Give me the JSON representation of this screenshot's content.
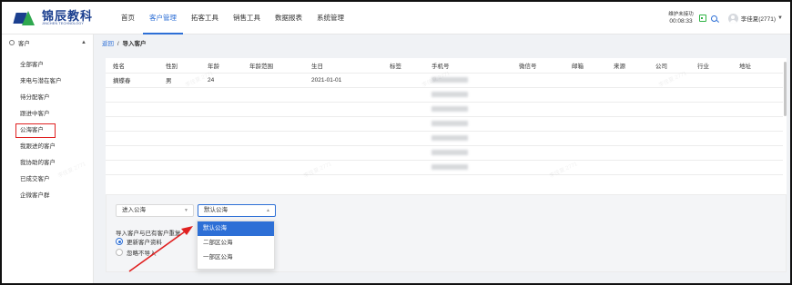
{
  "brand": {
    "name": "锦辰教科",
    "sub": "JINCHEN TECHNOLOGY",
    "colors": {
      "primary": "#2d6fd6",
      "brand_blue": "#1b3f8f",
      "brand_green": "#2fa84f",
      "annotation_red": "#e02020"
    }
  },
  "nav": {
    "items": [
      "首页",
      "客户管理",
      "拓客工具",
      "销售工具",
      "数据报表",
      "系统管理"
    ],
    "active": "客户管理"
  },
  "header_right": {
    "timer_label": "维护未接功",
    "timer_value": "00:08:33",
    "user_name": "李佳夏(2771)"
  },
  "sidebar": {
    "head": "客户",
    "items": [
      "全部客户",
      "来电与潜在客户",
      "待分配客户",
      "跟进中客户",
      "公海客户",
      "我跟进的客户",
      "我协助的客户",
      "已成交客户",
      "企微客户群"
    ],
    "highlighted": "公海客户"
  },
  "breadcrumb": {
    "back": "返回",
    "separator": "/",
    "current": "导入客户"
  },
  "table": {
    "columns": [
      "姓名",
      "性别",
      "年龄",
      "年龄范围",
      "生日",
      "标签",
      "手机号",
      "微信号",
      "邮箱",
      "来源",
      "公司",
      "行业",
      "地址"
    ],
    "rows": [
      {
        "name": "摘蝶春",
        "gender": "男",
        "age": "24",
        "birthday": "2021-01-01"
      }
    ],
    "empty_rows": 6
  },
  "import_config": {
    "target_select": "进入公海",
    "pool_select": "默认公海",
    "duplicate_label": "导入客户与已有客户重复",
    "radio_options": [
      "更新客户资料",
      "忽略不导入"
    ],
    "radio_selected": "更新客户资料",
    "dropdown_options": [
      "默认公海",
      "二部区公海",
      "一部区公海"
    ],
    "dropdown_selected": "默认公海"
  },
  "watermark_text": "李佳夏 2771"
}
